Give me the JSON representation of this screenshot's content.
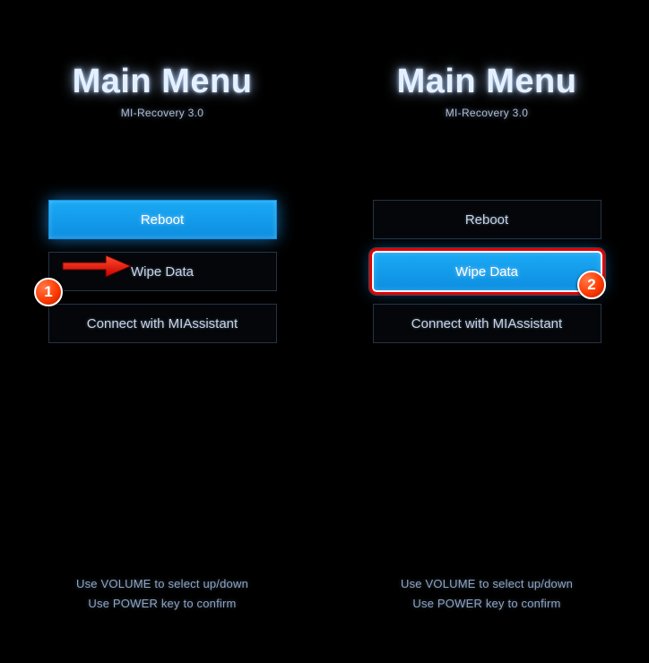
{
  "title": "Main Menu",
  "subtitle": "MI-Recovery 3.0",
  "menu": {
    "reboot": "Reboot",
    "wipe": "Wipe Data",
    "connect": "Connect with MIAssistant"
  },
  "hints": {
    "line1": "Use VOLUME to select up/down",
    "line2": "Use POWER key to confirm"
  },
  "badges": {
    "one": "1",
    "two": "2"
  }
}
